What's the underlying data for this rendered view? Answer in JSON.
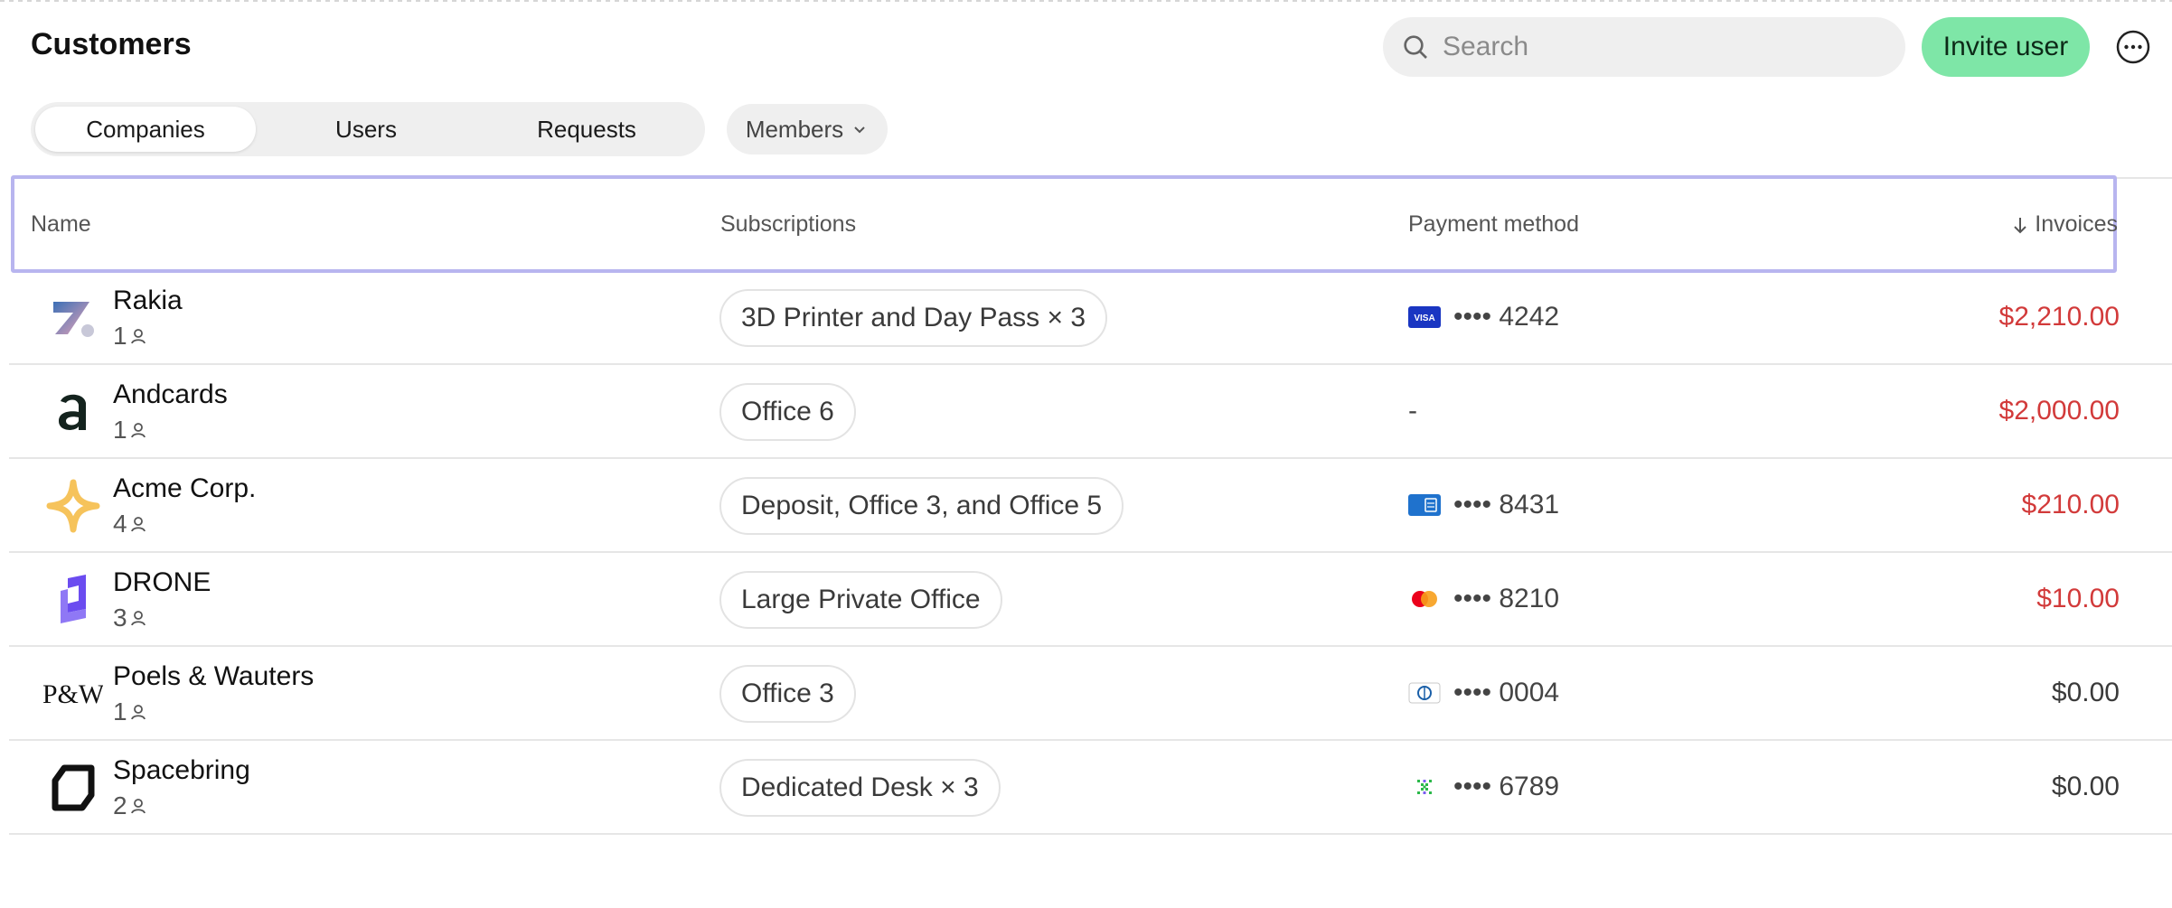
{
  "header": {
    "title": "Customers",
    "search_placeholder": "Search",
    "invite_label": "Invite user"
  },
  "tabs": [
    {
      "label": "Companies",
      "active": true
    },
    {
      "label": "Users",
      "active": false
    },
    {
      "label": "Requests",
      "active": false
    }
  ],
  "filter": {
    "label": "Members"
  },
  "table": {
    "columns": {
      "name": "Name",
      "subscriptions": "Subscriptions",
      "payment": "Payment method",
      "invoices": "Invoices"
    },
    "rows": [
      {
        "name": "Rakia",
        "members": "1",
        "subscription": "3D Printer and Day Pass × 3",
        "card_icon": "visa-card-icon",
        "payment": "•••• 4242",
        "invoice": "$2,210.00",
        "overdue": true
      },
      {
        "name": "Andcards",
        "members": "1",
        "subscription": "Office 6",
        "card_icon": "",
        "payment": "-",
        "invoice": "$2,000.00",
        "overdue": true
      },
      {
        "name": "Acme Corp.",
        "members": "4",
        "subscription": "Deposit, Office 3, and Office 5",
        "card_icon": "amex-card-icon",
        "payment": "•••• 8431",
        "invoice": "$210.00",
        "overdue": true
      },
      {
        "name": "DRONE",
        "members": "3",
        "subscription": "Large Private Office",
        "card_icon": "mastercard-icon",
        "payment": "•••• 8210",
        "invoice": "$10.00",
        "overdue": true
      },
      {
        "name": "Poels & Wauters",
        "members": "1",
        "subscription": "Office 3",
        "card_icon": "diners-card-icon",
        "payment": "•••• 0004",
        "invoice": "$0.00",
        "overdue": false
      },
      {
        "name": "Spacebring",
        "members": "2",
        "subscription": "Dedicated Desk × 3",
        "card_icon": "bank-debit-icon",
        "payment": "•••• 6789",
        "invoice": "$0.00",
        "overdue": false
      }
    ]
  },
  "colors": {
    "accent_green": "#7ee6a7",
    "header_outline": "#b8b5ef",
    "overdue_red": "#d23a3a"
  }
}
